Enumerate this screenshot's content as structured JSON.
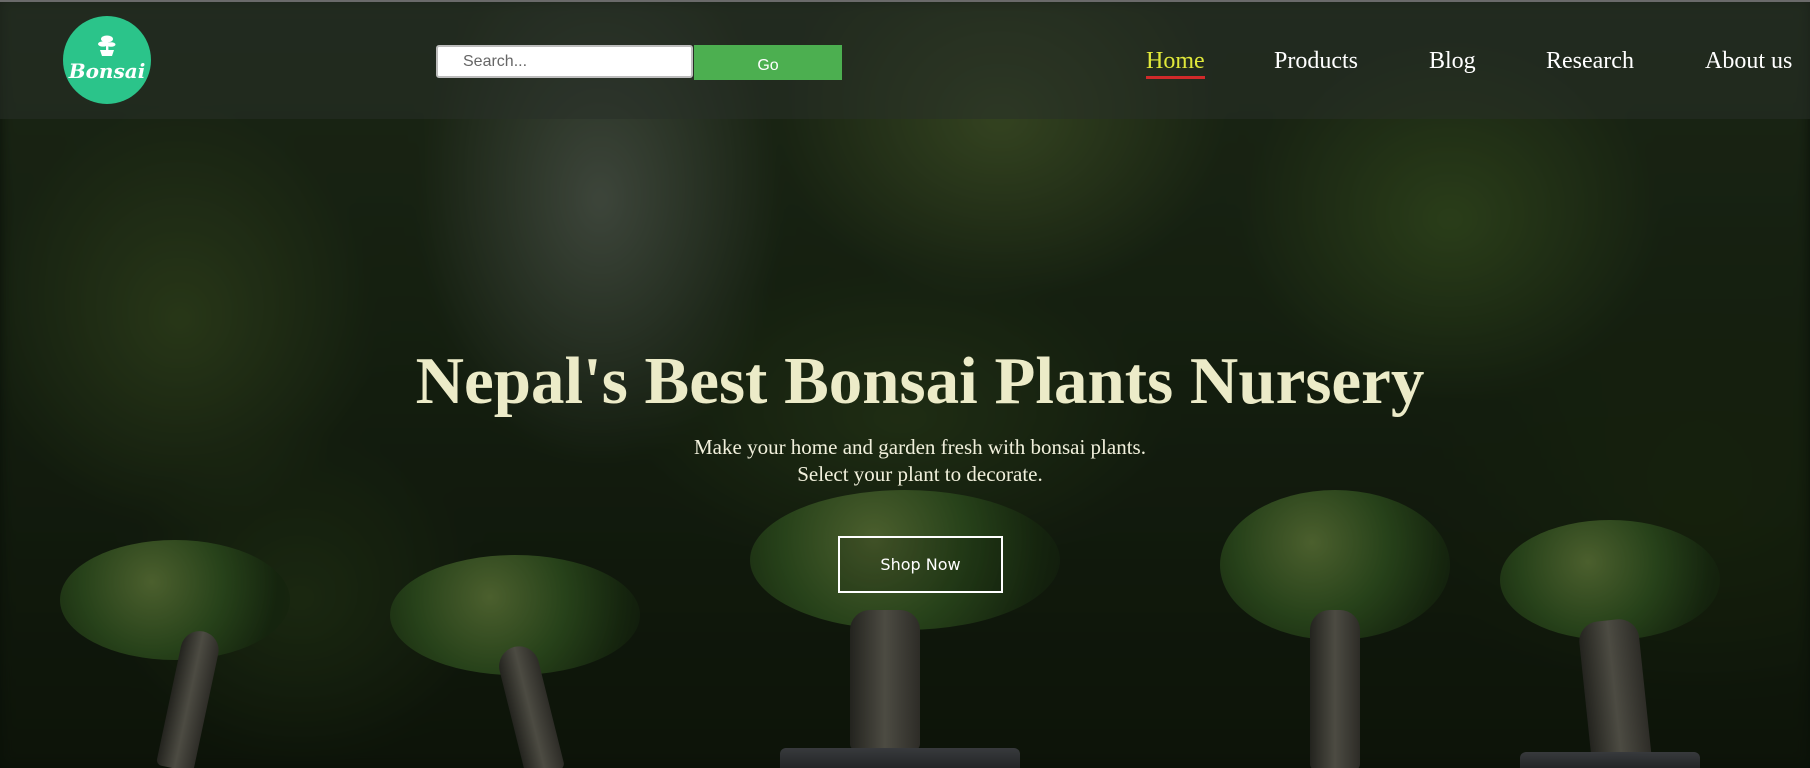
{
  "logo": {
    "text": "Bonsai",
    "icon": "bonsai-icon",
    "color": "#2bc48a"
  },
  "search": {
    "placeholder": "Search...",
    "value": "",
    "button_label": "Go",
    "button_color": "#4caf50"
  },
  "nav": {
    "items": [
      {
        "label": "Home",
        "active": true
      },
      {
        "label": "Products",
        "active": false
      },
      {
        "label": "Blog",
        "active": false
      },
      {
        "label": "Research",
        "active": false
      },
      {
        "label": "About us",
        "active": false
      }
    ],
    "active_color": "#e0e83a",
    "active_underline_color": "#d12a2a"
  },
  "hero": {
    "title": "Nepal's Best Bonsai Plants Nursery",
    "subtitle_line1": "Make your home and garden fresh with bonsai plants.",
    "subtitle_line2": "Select your plant to decorate.",
    "cta_label": "Shop Now"
  }
}
